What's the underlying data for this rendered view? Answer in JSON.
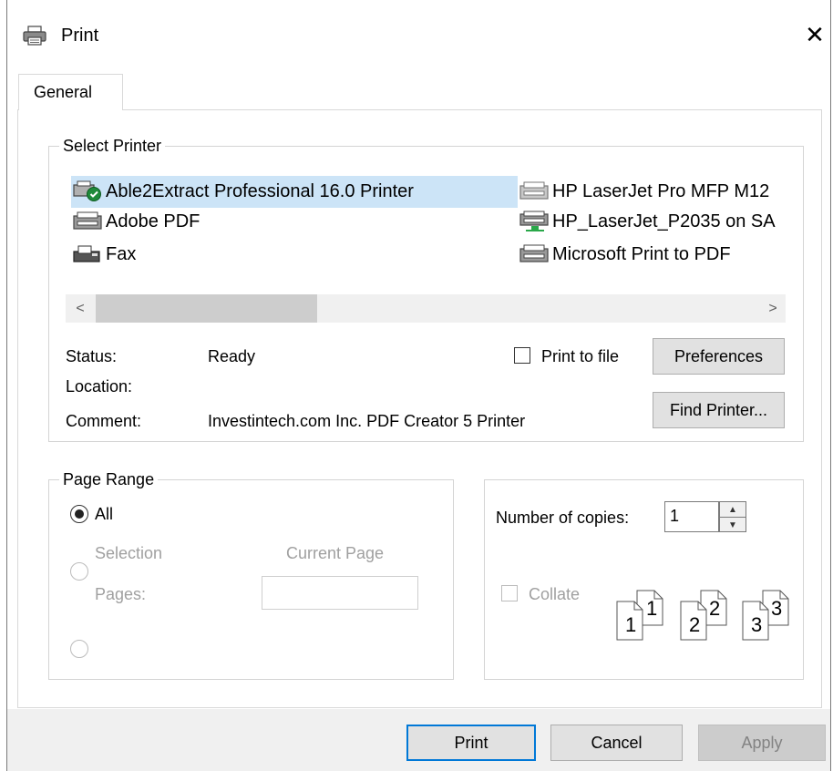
{
  "window": {
    "title": "Print",
    "title_icon": "printer-icon",
    "close_glyph": "✕"
  },
  "tabs": [
    {
      "label": "General",
      "selected": true
    }
  ],
  "select_printer": {
    "legend": "Select Printer",
    "printers": [
      {
        "name": "Able2Extract Professional 16.0 Printer",
        "icon": "default-printer-icon",
        "selected": true
      },
      {
        "name": "Adobe PDF",
        "icon": "printer-icon"
      },
      {
        "name": "Fax",
        "icon": "fax-icon"
      },
      {
        "name": "HP LaserJet Pro MFP M12",
        "icon": "printer-icon"
      },
      {
        "name": "HP_LaserJet_P2035 on SA",
        "icon": "network-printer-icon"
      },
      {
        "name": "Microsoft Print to PDF",
        "icon": "printer-icon"
      }
    ],
    "scroll_left": "<",
    "scroll_right": ">",
    "status_label": "Status:",
    "status_value": "Ready",
    "location_label": "Location:",
    "location_value": "",
    "comment_label": "Comment:",
    "comment_value": "Investintech.com Inc. PDF Creator 5 Printer",
    "print_to_file_label": "Print to file",
    "print_to_file_checked": false,
    "preferences_label": "Preferences",
    "find_printer_label": "Find Printer..."
  },
  "page_range": {
    "legend": "Page Range",
    "all_label": "All",
    "selection_label": "Selection",
    "current_page_label": "Current Page",
    "pages_label": "Pages:",
    "pages_value": "",
    "selected_option": "All"
  },
  "copies": {
    "number_label": "Number of copies:",
    "number_value": "1",
    "collate_label": "Collate",
    "collate_checked": false,
    "collate_pages": [
      "1",
      "1",
      "2",
      "2",
      "3",
      "3"
    ]
  },
  "buttons": {
    "print": "Print",
    "cancel": "Cancel",
    "apply": "Apply"
  },
  "colors": {
    "selection": "#cce4f7",
    "default_button_border": "#0078d7",
    "button_face": "#e1e1e1",
    "disabled_text": "#a0a0a0"
  }
}
